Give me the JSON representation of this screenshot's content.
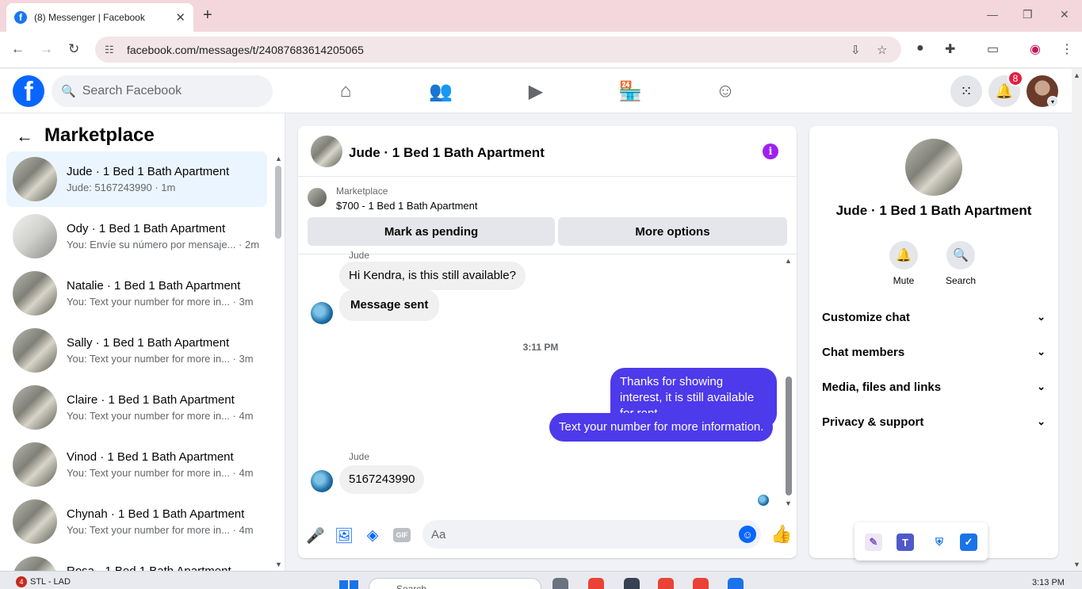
{
  "browser": {
    "tab_title": "(8) Messenger | Facebook",
    "tab_close": "✕",
    "new_tab": "+",
    "url": "facebook.com/messages/t/24087683614205065"
  },
  "header": {
    "logo": "f",
    "search_placeholder": "Search Facebook",
    "notification_count": "8",
    "icons": [
      "home-icon",
      "friends-icon",
      "video-icon",
      "marketplace-icon",
      "groups-icon",
      "menu-grid-icon",
      "bell-icon"
    ]
  },
  "sidebar": {
    "title": "Marketplace",
    "conversations": [
      {
        "name": "Jude · 1 Bed 1 Bath Apartment",
        "preview": "Jude: 5167243990 · 1m",
        "active": true
      },
      {
        "name": "Ody · 1 Bed 1 Bath Apartment",
        "preview": "You: Envíe su número por mensaje... · 2m",
        "active": false
      },
      {
        "name": "Natalie · 1 Bed 1 Bath Apartment",
        "preview": "You: Text your number for more in... · 3m",
        "active": false
      },
      {
        "name": "Sally · 1 Bed 1 Bath Apartment",
        "preview": "You: Text your number for more in... · 3m",
        "active": false
      },
      {
        "name": "Claire · 1 Bed 1 Bath Apartment",
        "preview": "You: Text your number for more in... · 4m",
        "active": false
      },
      {
        "name": "Vinod · 1 Bed 1 Bath Apartment",
        "preview": "You: Text your number for more in... · 4m",
        "active": false
      },
      {
        "name": "Chynah · 1 Bed 1 Bath Apartment",
        "preview": "You: Text your number for more in... · 4m",
        "active": false
      },
      {
        "name": "Rosa · 1 Bed 1 Bath Apartment",
        "preview": "",
        "active": false
      }
    ]
  },
  "chat": {
    "title": "Jude · 1 Bed 1 Bath Apartment",
    "listing_source": "Marketplace",
    "listing_title": "$700 - 1 Bed 1 Bath Apartment",
    "mark_pending_label": "Mark as pending",
    "more_options_label": "More options",
    "sender_top": "Jude",
    "messages": [
      {
        "from": "in",
        "text": "Hi Kendra, is this still available?"
      },
      {
        "from": "in",
        "text": "Message sent"
      },
      {
        "from": "out",
        "text": "Thanks for showing interest, it is still available for rent."
      },
      {
        "from": "out",
        "text": "Text your number for more information."
      },
      {
        "from": "in",
        "text": "5167243990"
      }
    ],
    "timestamp": "3:11 PM",
    "sender_bottom": "Jude",
    "composer_placeholder": "Aa",
    "gif_label": "GIF"
  },
  "info_panel": {
    "name": "Jude · 1 Bed 1 Bath Apartment",
    "mute_label": "Mute",
    "search_label": "Search",
    "sections": [
      "Customize chat",
      "Chat members",
      "Media, files and links",
      "Privacy & support"
    ]
  },
  "taskbar": {
    "weather_badge": "4",
    "weather_text": "STL - LAD",
    "search_placeholder": "Search",
    "time": "3:13 PM"
  }
}
